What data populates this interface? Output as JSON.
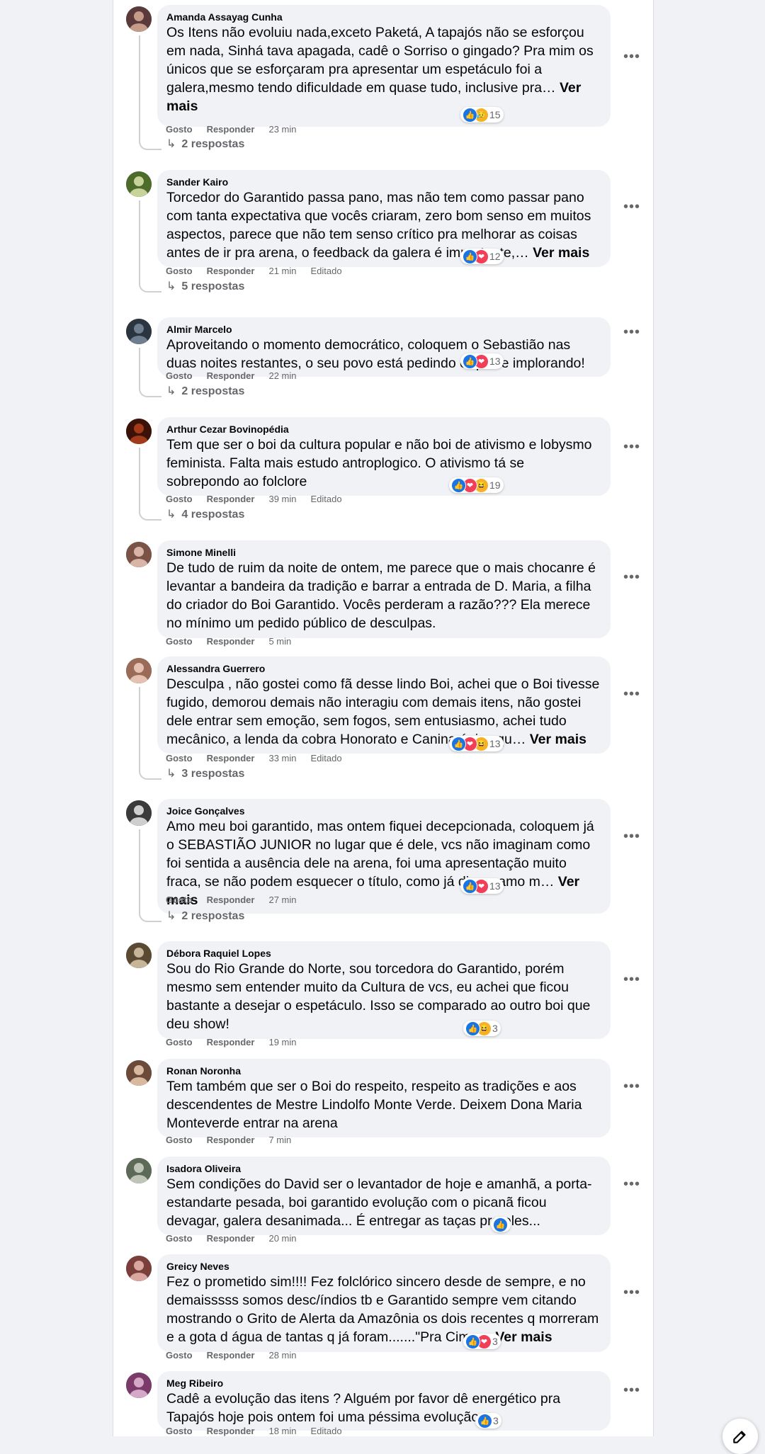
{
  "labels": {
    "like": "Gosto",
    "reply": "Responder",
    "edited": "Editado",
    "see_more": "Ver mais"
  },
  "comments": [
    {
      "name": "Amanda Assayag Cunha",
      "text": "Os Itens não evoluiu nada,exceto Paketá, A tapajós não se esforçou em nada, Sinhá tava apagada, cadê o Sorriso o gingado? Pra mim os únicos que se esforçaram pra apresentar um espetáculo foi a galera,mesmo tendo dificuldade em quase tudo, inclusive pra…",
      "time": "23 min",
      "reactions": [
        "like",
        "sad"
      ],
      "count": "15",
      "replies": "2 respostas"
    },
    {
      "name": "Sander Kairo",
      "text": "Torcedor do Garantido passa pano, mas não tem como passar pano com tanta expectativa que vocês criaram, zero bom senso em muitos aspectos, parece que não tem senso crítico pra melhorar as coisas antes de ir pra arena, o feedback da galera é importante,…",
      "time": "21 min",
      "reactions": [
        "like",
        "love"
      ],
      "count": "12",
      "replies": "5 respostas"
    },
    {
      "name": "Almir Marcelo",
      "text": "Aproveitando o momento democrático, coloquem o Sebastião nas duas noites restantes, o seu povo está pedindo e quase implorando!",
      "time": "22 min",
      "reactions": [
        "like",
        "love"
      ],
      "count": "13",
      "replies": "2 respostas"
    },
    {
      "name": "Arthur Cezar Bovinopédia",
      "text": "Tem que ser o boi da cultura popular e não boi de ativismo e lobysmo feminista. Falta mais estudo antroplogico. O ativismo tá se sobrepondo ao folclore",
      "time": "39 min",
      "reactions": [
        "like",
        "love",
        "haha"
      ],
      "count": "19",
      "replies": "4 respostas"
    },
    {
      "name": "Simone Minelli",
      "text": "De tudo de ruim da noite de ontem, me parece que o mais chocanre é levantar a bandeira da tradição e barrar a entrada de D. Maria, a filha do criador do Boi Garantido. Vocês perderam a razão??? Ela merece no mínimo um pedido público de desculpas.",
      "time": "5 min"
    },
    {
      "name": "Alessandra Guerrero",
      "text": "Desculpa , não gostei como fã desse lindo Boi, achei que o Boi tivesse fugido, demorou demais não interagiu com demais itens, não gostei dele entrar sem emoção, sem fogos, sem entusiasmo, achei tudo mecânico, a lenda da cobra Honorato e Canina único qu…",
      "time": "33 min",
      "reactions": [
        "like",
        "love",
        "haha"
      ],
      "count": "13",
      "replies": "3 respostas"
    },
    {
      "name": "Joice Gonçalves",
      "text": "Amo meu boi garantido, mas ontem fiquei decepcionada, coloquem já o SEBASTIÃO JUNIOR no lugar que é dele, vcs não imaginam como foi sentida a ausência dele na arena, foi uma apresentação muito fraca, se não podem esquecer o título, como já disse, amo m…",
      "time": "27 min",
      "reactions": [
        "like",
        "love"
      ],
      "count": "13",
      "replies": "2 respostas"
    },
    {
      "name": "Débora Raquiel Lopes",
      "text": "Sou do Rio Grande do Norte, sou torcedora do Garantido, porém mesmo sem entender muito da Cultura de vcs, eu achei que ficou bastante a desejar o espetáculo. Isso se comparado ao outro boi que deu show!",
      "time": "19 min",
      "reactions": [
        "like",
        "haha"
      ],
      "count": "3"
    },
    {
      "name": "Ronan Noronha",
      "text": "Tem também que ser o Boi do respeito, respeito as tradições e aos descendentes de Mestre Lindolfo Monte Verde. Deixem Dona Maria Monteverde entrar na arena",
      "time": "7 min"
    },
    {
      "name": "Isadora Oliveira",
      "text": "Sem condições do David ser o levantador de hoje e amanhã, a porta-estandarte pesada, boi garantido evolução com o picanã ficou devagar, galera desanimada... É entregar as taças pra eles...",
      "time": "20 min",
      "reactions": [
        "like"
      ],
      "count": ""
    },
    {
      "name": "Greicy Neves",
      "text": "Fez o prometido sim!!!! Fez folclórico sincero desde de sempre, e no demaisssss somos desc/índios tb e Garantido sempre vem citando mostrando o Grito de Alerta da Amazônia os dois recentes q morreram e a gota d água de tantas q já foram.......\"Pra Cima…",
      "time": "28 min",
      "reactions": [
        "like",
        "love"
      ],
      "count": "3"
    },
    {
      "name": "Meg Ribeiro",
      "text": "Cadê a evolução das itens ? Alguém por favor dê energético pra Tapajós hoje pois ontem foi uma péssima evolução.",
      "time": "18 min",
      "reactions": [
        "like"
      ],
      "count": "3"
    }
  ]
}
